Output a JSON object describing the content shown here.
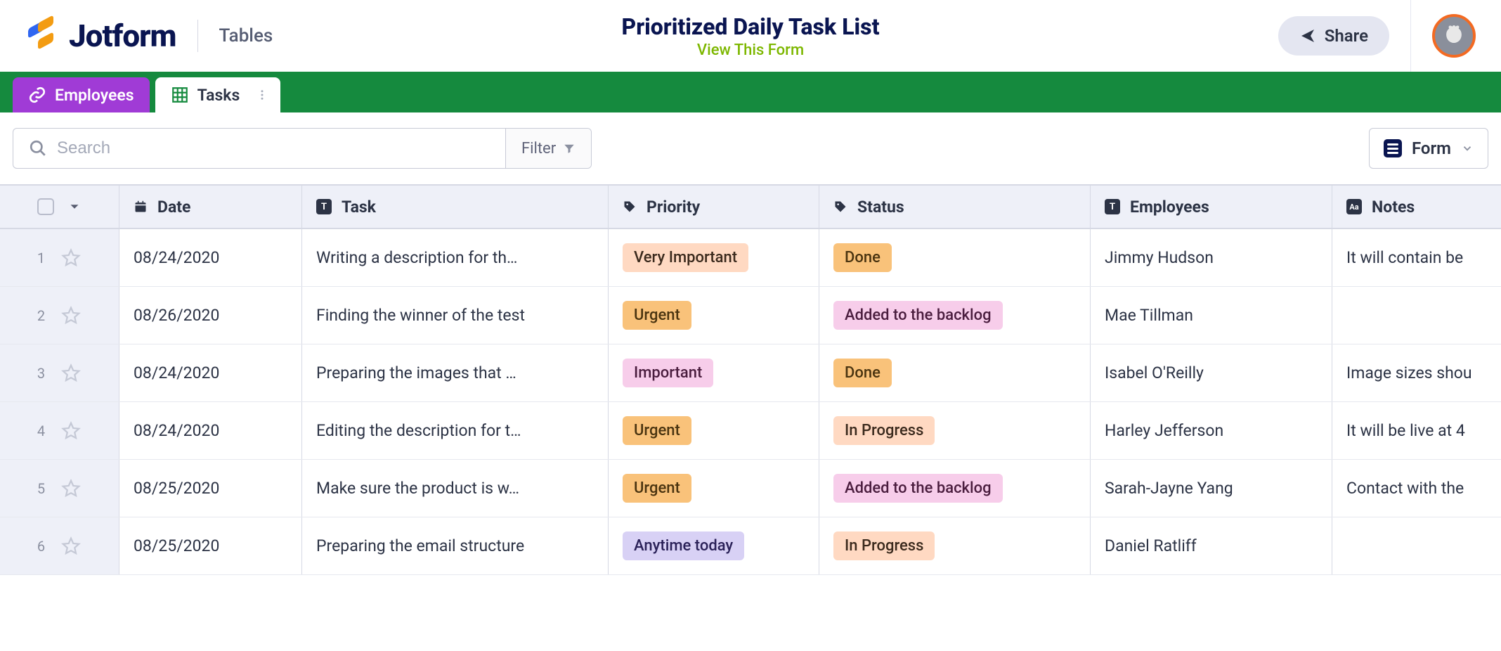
{
  "header": {
    "brand": "Jotform",
    "section": "Tables",
    "title": "Prioritized Daily Task List",
    "subtitle": "View This Form",
    "share_label": "Share"
  },
  "tabs": {
    "employees": "Employees",
    "tasks": "Tasks"
  },
  "toolbar": {
    "search_placeholder": "Search",
    "filter_label": "Filter",
    "form_label": "Form"
  },
  "columns": {
    "date": "Date",
    "task": "Task",
    "priority": "Priority",
    "status": "Status",
    "employees": "Employees",
    "notes": "Notes"
  },
  "rows": [
    {
      "n": "1",
      "date": "08/24/2020",
      "task": "Writing a description for th…",
      "priority": "Very Important",
      "status": "Done",
      "employees": "Jimmy Hudson",
      "notes": "It will contain be"
    },
    {
      "n": "2",
      "date": "08/26/2020",
      "task": "Finding the winner of the test",
      "priority": "Urgent",
      "status": "Added to the backlog",
      "employees": "Mae Tillman",
      "notes": ""
    },
    {
      "n": "3",
      "date": "08/24/2020",
      "task": "Preparing the images that …",
      "priority": "Important",
      "status": "Done",
      "employees": "Isabel O'Reilly",
      "notes": "Image sizes shou"
    },
    {
      "n": "4",
      "date": "08/24/2020",
      "task": "Editing the description for t…",
      "priority": "Urgent",
      "status": "In Progress",
      "employees": "Harley Jefferson",
      "notes": "It will be live at 4"
    },
    {
      "n": "5",
      "date": "08/25/2020",
      "task": "Make sure the product is w…",
      "priority": "Urgent",
      "status": "Added to the backlog",
      "employees": "Sarah-Jayne Yang",
      "notes": "Contact with the"
    },
    {
      "n": "6",
      "date": "08/25/2020",
      "task": "Preparing the email structure",
      "priority": "Anytime today",
      "status": "In Progress",
      "employees": "Daniel Ratliff",
      "notes": ""
    }
  ]
}
